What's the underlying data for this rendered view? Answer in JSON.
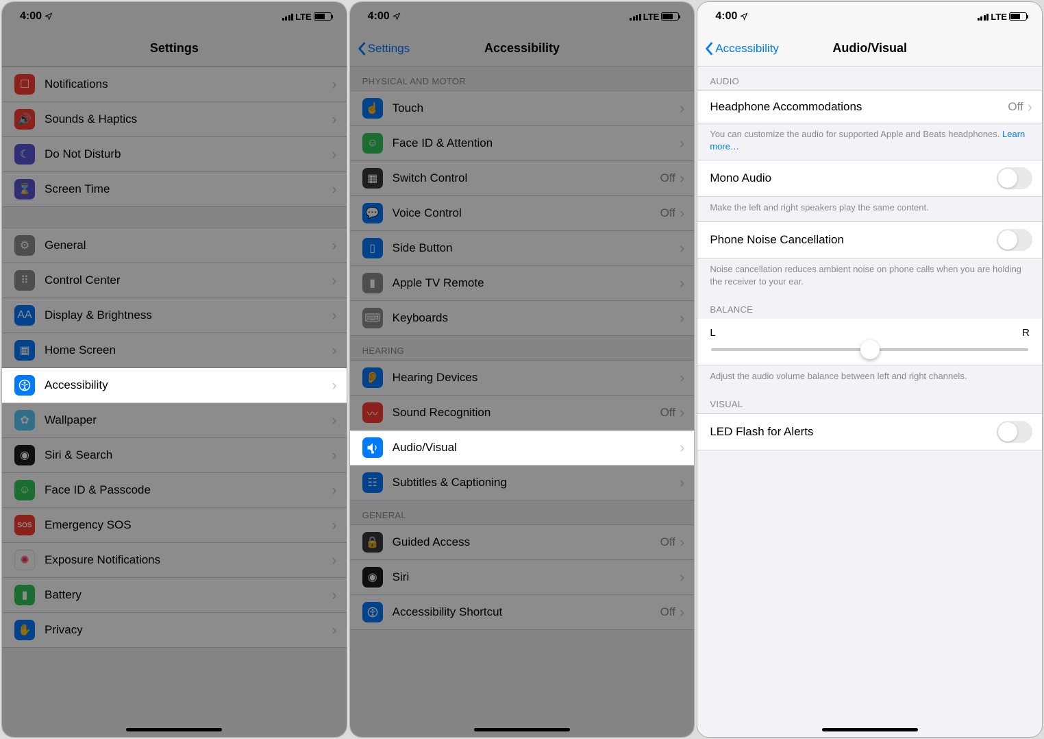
{
  "status": {
    "time": "4:00",
    "carrier": "LTE"
  },
  "screen1": {
    "title": "Settings",
    "group1": [
      {
        "label": "Notifications"
      },
      {
        "label": "Sounds & Haptics"
      },
      {
        "label": "Do Not Disturb"
      },
      {
        "label": "Screen Time"
      }
    ],
    "group2": [
      {
        "label": "General"
      },
      {
        "label": "Control Center"
      },
      {
        "label": "Display & Brightness"
      },
      {
        "label": "Home Screen"
      },
      {
        "label": "Accessibility"
      },
      {
        "label": "Wallpaper"
      },
      {
        "label": "Siri & Search"
      },
      {
        "label": "Face ID & Passcode"
      },
      {
        "label": "Emergency SOS"
      },
      {
        "label": "Exposure Notifications"
      },
      {
        "label": "Battery"
      },
      {
        "label": "Privacy"
      }
    ]
  },
  "screen2": {
    "back": "Settings",
    "title": "Accessibility",
    "sectionPhysical": "PHYSICAL AND MOTOR",
    "physical": [
      {
        "label": "Touch"
      },
      {
        "label": "Face ID & Attention"
      },
      {
        "label": "Switch Control",
        "value": "Off"
      },
      {
        "label": "Voice Control",
        "value": "Off"
      },
      {
        "label": "Side Button"
      },
      {
        "label": "Apple TV Remote"
      },
      {
        "label": "Keyboards"
      }
    ],
    "sectionHearing": "HEARING",
    "hearing": [
      {
        "label": "Hearing Devices"
      },
      {
        "label": "Sound Recognition",
        "value": "Off"
      },
      {
        "label": "Audio/Visual"
      },
      {
        "label": "Subtitles & Captioning"
      }
    ],
    "sectionGeneral": "GENERAL",
    "general": [
      {
        "label": "Guided Access",
        "value": "Off"
      },
      {
        "label": "Siri"
      },
      {
        "label": "Accessibility Shortcut",
        "value": "Off"
      }
    ]
  },
  "screen3": {
    "back": "Accessibility",
    "title": "Audio/Visual",
    "sectionAudio": "AUDIO",
    "headphone": {
      "label": "Headphone Accommodations",
      "value": "Off"
    },
    "headphoneFooter": "You can customize the audio for supported Apple and Beats headphones. ",
    "learnMore": "Learn more…",
    "monoAudio": {
      "label": "Mono Audio"
    },
    "monoFooter": "Make the left and right speakers play the same content.",
    "noiseCancel": {
      "label": "Phone Noise Cancellation"
    },
    "noiseFooter": "Noise cancellation reduces ambient noise on phone calls when you are holding the receiver to your ear.",
    "sectionBalance": "BALANCE",
    "balanceL": "L",
    "balanceR": "R",
    "balanceFooter": "Adjust the audio volume balance between left and right channels.",
    "sectionVisual": "VISUAL",
    "ledFlash": {
      "label": "LED Flash for Alerts"
    }
  }
}
